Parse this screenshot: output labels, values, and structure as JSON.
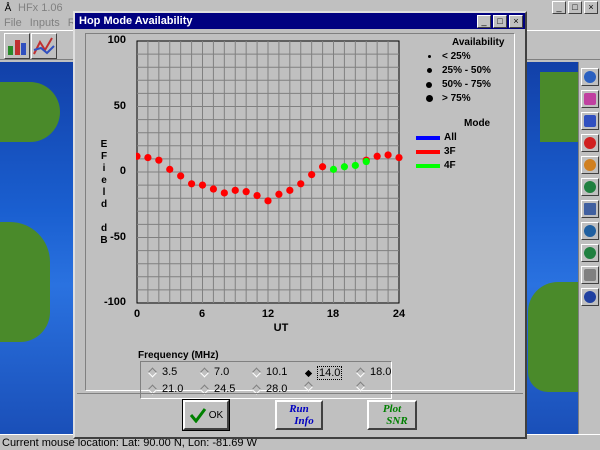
{
  "app": {
    "title": "HFx 1.06",
    "menu": [
      "File",
      "Inputs",
      "Run"
    ],
    "status": "Current mouse location:  Lat: 90.00 N,  Lon: -81.69 W",
    "window_buttons": {
      "minimize": "_",
      "maximize": "□",
      "close": "×"
    }
  },
  "dialog": {
    "title": "Hop Mode Availability",
    "buttons": {
      "ok": "OK",
      "run_info": [
        "Run",
        "Info"
      ],
      "plot_snr": [
        "Plot",
        "SNR"
      ]
    },
    "frequency": {
      "label": "Frequency (MHz)",
      "options": [
        "3.5",
        "7.0",
        "10.1",
        "14.0",
        "18.0",
        "21.0",
        "24.5",
        "28.0",
        "",
        ""
      ],
      "selected": "14.0"
    }
  },
  "chart_data": {
    "type": "scatter",
    "ylabel_letters": [
      "E",
      "F",
      "i",
      "e",
      "l",
      "d",
      "",
      "d",
      "B"
    ],
    "xlabel": "UT",
    "x_ticks": [
      "0",
      "6",
      "12",
      "18",
      "24"
    ],
    "y_ticks": [
      "100",
      "50",
      "0",
      "-50",
      "-100"
    ],
    "xlim": [
      0,
      24
    ],
    "ylim": [
      -100,
      100
    ],
    "grid": true,
    "legend": {
      "availability_title": "Availability",
      "availability": [
        "< 25%",
        "25% - 50%",
        "50% - 75%",
        "> 75%"
      ],
      "mode_title": "Mode",
      "modes": [
        {
          "name": "All",
          "color": "#0000ff"
        },
        {
          "name": "3F",
          "color": "#ff0000"
        },
        {
          "name": "4F",
          "color": "#00ff00"
        }
      ]
    },
    "series": [
      {
        "name": "3F",
        "color": "#ff0000",
        "x": [
          0,
          1,
          2,
          3,
          4,
          5,
          6,
          7,
          8,
          9,
          10,
          11,
          12,
          13,
          14,
          15,
          16,
          17,
          21,
          22,
          23,
          24
        ],
        "y": [
          12,
          11,
          9,
          2,
          -3,
          -9,
          -10,
          -13,
          -16,
          -14,
          -15,
          -18,
          -22,
          -17,
          -14,
          -9,
          -2,
          4,
          9,
          12,
          13,
          11
        ]
      },
      {
        "name": "4F",
        "color": "#00ff00",
        "x": [
          18,
          19,
          20,
          21
        ],
        "y": [
          2,
          4,
          5,
          8
        ]
      }
    ]
  }
}
